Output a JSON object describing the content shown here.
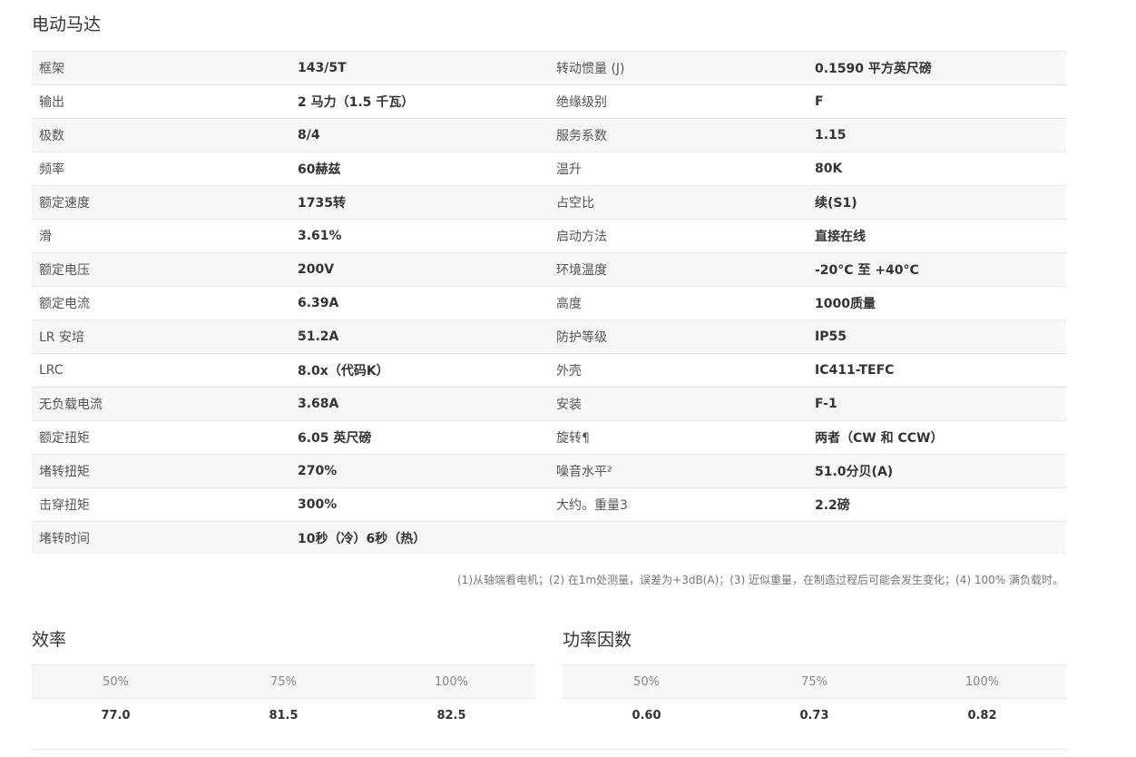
{
  "title": "电动马达",
  "specs": [
    [
      "框架",
      "143/5T",
      "转动惯量 (J)",
      "0.1590 平方英尺磅"
    ],
    [
      "输出",
      "2 马力（1.5 千瓦）",
      "绝缘级别",
      "F"
    ],
    [
      "极数",
      "8/4",
      "服务系数",
      "1.15"
    ],
    [
      "频率",
      "60赫兹",
      "温升",
      "80K"
    ],
    [
      "额定速度",
      "1735转",
      "占空比",
      "续(S1)"
    ],
    [
      "滑",
      "3.61%",
      "启动方法",
      "直接在线"
    ],
    [
      "额定电压",
      "200V",
      "环境温度",
      "-20°C 至 +40°C"
    ],
    [
      "额定电流",
      "6.39A",
      "高度",
      "1000质量"
    ],
    [
      "LR 安培",
      "51.2A",
      "防护等级",
      "IP55"
    ],
    [
      "LRC",
      "8.0x（代码K）",
      "外壳",
      "IC411-TEFC"
    ],
    [
      "无负载电流",
      "3.68A",
      "安装",
      "F-1"
    ],
    [
      "额定扭矩",
      "6.05 英尺磅",
      "旋转¶",
      "两者（CW 和 CCW）"
    ],
    [
      "堵转扭矩",
      "270%",
      "噪音水平²",
      "51.0分贝(A)"
    ],
    [
      "击穿扭矩",
      "300%",
      "大约。重量3",
      "2.2磅"
    ],
    [
      "堵转时间",
      "10秒（冷）6秒（热）",
      "",
      ""
    ]
  ],
  "footnote": "(1)从轴端看电机；(2) 在1m处测量，误差为+3dB(A)；(3) 近似重量，在制造过程后可能会发生变化；(4) 100% 满负载时。",
  "efficiency": {
    "title": "效率",
    "headers": [
      "50%",
      "75%",
      "100%"
    ],
    "values": [
      "77.0",
      "81.5",
      "82.5"
    ]
  },
  "power_factor": {
    "title": "功率因数",
    "headers": [
      "50%",
      "75%",
      "100%"
    ],
    "values": [
      "0.60",
      "0.73",
      "0.82"
    ]
  }
}
